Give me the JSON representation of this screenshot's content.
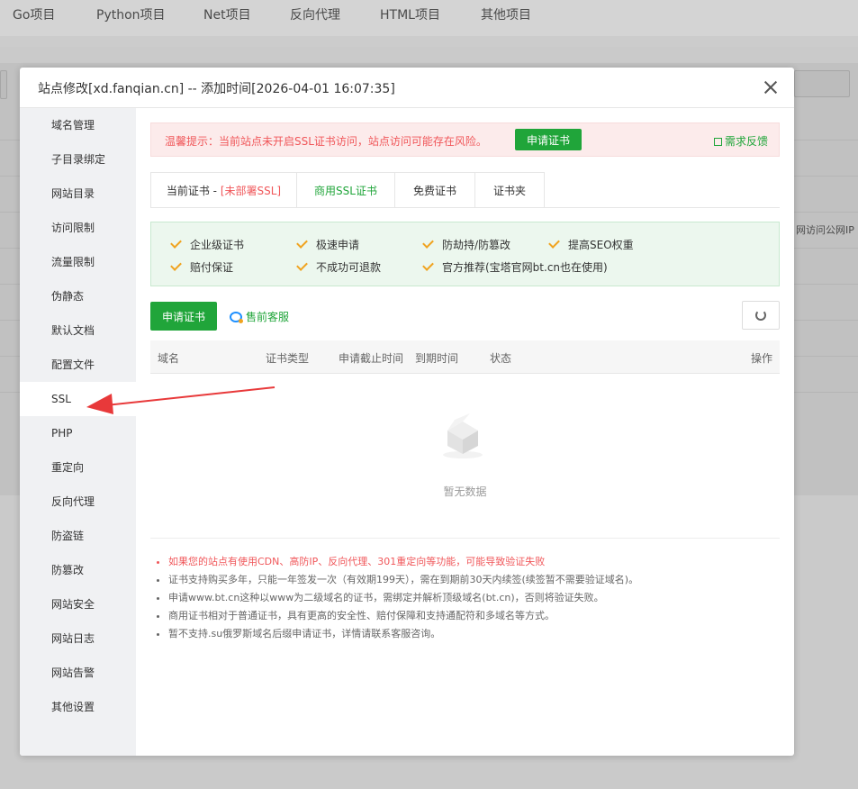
{
  "background": {
    "tabs": [
      "Go项目",
      "Python项目",
      "Net项目",
      "反向代理",
      "HTML项目",
      "其他项目"
    ],
    "right_edge_text": "网访问公网IP"
  },
  "modal": {
    "title": "站点修改[xd.fanqian.cn] -- 添加时间[2026-04-01 16:07:35]",
    "sidebar": [
      "域名管理",
      "子目录绑定",
      "网站目录",
      "访问限制",
      "流量限制",
      "伪静态",
      "默认文档",
      "配置文件",
      "SSL",
      "PHP",
      "重定向",
      "反向代理",
      "防盗链",
      "防篡改",
      "网站安全",
      "网站日志",
      "网站告警",
      "其他设置"
    ],
    "active_sidebar": "SSL",
    "alert": {
      "text": "温馨提示：当前站点未开启SSL证书访问，站点访问可能存在风险。",
      "button": "申请证书",
      "feedback": "需求反馈"
    },
    "tabs": {
      "current_prefix": "当前证书 - ",
      "current_status": "[未部署SSL]",
      "commercial": "商用SSL证书",
      "free": "免费证书",
      "folder": "证书夹"
    },
    "features": [
      "企业级证书",
      "极速申请",
      "防劫持/防篡改",
      "提高SEO权重",
      "赔付保证",
      "不成功可退款",
      "官方推荐(宝塔官网bt.cn也在使用)"
    ],
    "actions": {
      "apply": "申请证书",
      "presale": "售前客服"
    },
    "table": {
      "columns": [
        "域名",
        "证书类型",
        "申请截止时间",
        "到期时间",
        "状态",
        "操作"
      ],
      "empty": "暂无数据"
    },
    "notes": [
      "如果您的站点有使用CDN、高防IP、反向代理、301重定向等功能，可能导致验证失败",
      "证书支持购买多年，只能一年签发一次（有效期199天），需在到期前30天内续签(续签暂不需要验证域名)。",
      "申请www.bt.cn这种以www为二级域名的证书，需绑定并解析顶级域名(bt.cn)，否则将验证失败。",
      "商用证书相对于普通证书，具有更高的安全性、赔付保障和支持通配符和多域名等方式。",
      "暂不支持.su俄罗斯域名后缀申请证书，详情请联系客服咨询。"
    ],
    "colors": {
      "accent": "#20a53a",
      "warning": "#f0575a",
      "check": "#f0a31f",
      "arrow": "#e8393a"
    }
  }
}
